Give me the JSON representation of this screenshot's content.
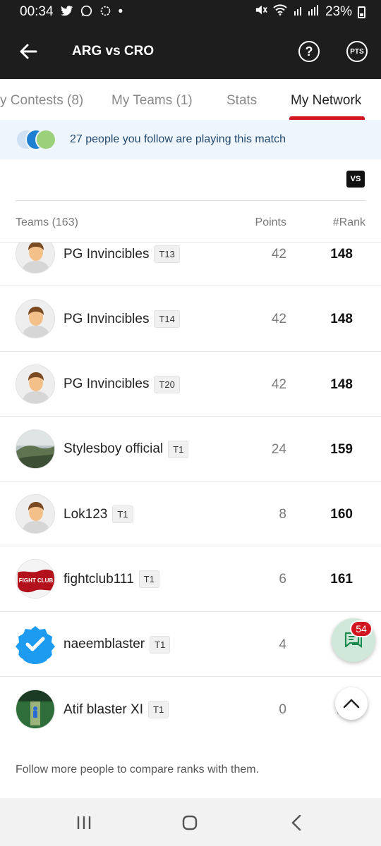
{
  "status_bar": {
    "time": "00:34",
    "battery": "23%",
    "notif_dot": "•"
  },
  "header": {
    "title": "ARG vs CRO",
    "help_symbol": "?",
    "pts_label": "PTS"
  },
  "tabs": [
    {
      "label": "y Contests (8)",
      "active": false
    },
    {
      "label": "My Teams (1)",
      "active": false
    },
    {
      "label": "Stats",
      "active": false
    },
    {
      "label": "My Network",
      "active": true
    }
  ],
  "banner": {
    "text": "27 people you follow are playing this match"
  },
  "vs_label": "VS",
  "table": {
    "teams_header": "Teams (163)",
    "points_header": "Points",
    "rank_header": "#Rank",
    "rows": [
      {
        "name": "PG Invincibles",
        "team": "T13",
        "points": "42",
        "rank": "148",
        "avatar": "default-avatar"
      },
      {
        "name": "PG Invincibles",
        "team": "T14",
        "points": "42",
        "rank": "148",
        "avatar": "default-avatar"
      },
      {
        "name": "PG Invincibles",
        "team": "T20",
        "points": "42",
        "rank": "148",
        "avatar": "default-avatar"
      },
      {
        "name": "Stylesboy official",
        "team": "T1",
        "points": "24",
        "rank": "159",
        "avatar": "landscape-photo"
      },
      {
        "name": "Lok123",
        "team": "T1",
        "points": "8",
        "rank": "160",
        "avatar": "default-avatar"
      },
      {
        "name": "fightclub111",
        "team": "T1",
        "points": "6",
        "rank": "161",
        "avatar": "fightclub-logo"
      },
      {
        "name": "naeemblaster",
        "team": "T1",
        "points": "4",
        "rank": "",
        "avatar": "verified-badge"
      },
      {
        "name": "Atif blaster XI",
        "team": "T1",
        "points": "0",
        "rank": "1",
        "avatar": "cricket-photo"
      }
    ]
  },
  "fightclub_logo_text": "FIGHT CLUB",
  "footer_note": "Follow more people to compare ranks with them.",
  "chat": {
    "badge_count": "54"
  },
  "colors": {
    "accent": "#d0161f",
    "header_bg": "#1d1d1d",
    "banner_bg": "#eef5fc",
    "chat_fab": "#cfe8da"
  }
}
